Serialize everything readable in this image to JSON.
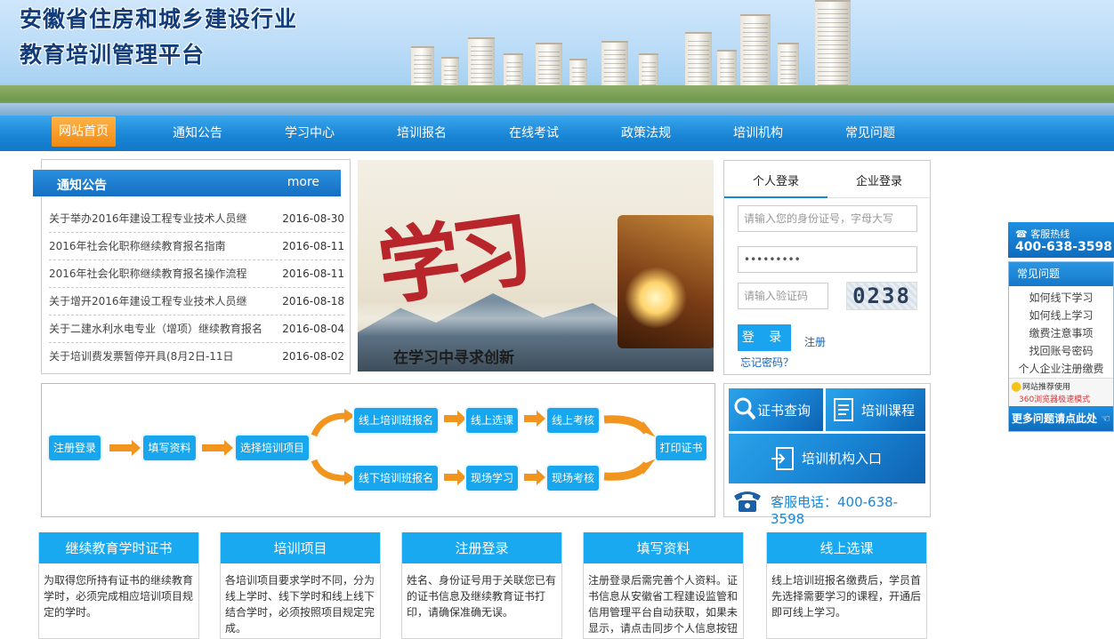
{
  "banner": {
    "title_line1": "安徽省住房和城乡建设行业",
    "title_line2": "教育培训管理平台"
  },
  "nav": {
    "items": [
      {
        "label": "网站首页",
        "active": true
      },
      {
        "label": "通知公告"
      },
      {
        "label": "学习中心"
      },
      {
        "label": "培训报名"
      },
      {
        "label": "在线考试"
      },
      {
        "label": "政策法规"
      },
      {
        "label": "培训机构"
      },
      {
        "label": "常见问题"
      }
    ]
  },
  "notice": {
    "title": "通知公告",
    "more": "more",
    "items": [
      {
        "title": "关于举办2016年建设工程专业技术人员继",
        "date": "2016-08-30"
      },
      {
        "title": "2016年社会化职称继续教育报名指南",
        "date": "2016-08-11"
      },
      {
        "title": "2016年社会化职称继续教育报名操作流程",
        "date": "2016-08-11"
      },
      {
        "title": "关于增开2016年建设工程专业技术人员继",
        "date": "2016-08-18"
      },
      {
        "title": "关于二建水利水电专业（增项）继续教育报名",
        "date": "2016-08-04"
      },
      {
        "title": "关于培训费发票暂停开具(8月2日-11日",
        "date": "2016-08-02"
      }
    ]
  },
  "slide": {
    "big_text": "学习",
    "caption": "在学习中寻求创新"
  },
  "login": {
    "tab_personal": "个人登录",
    "tab_company": "企业登录",
    "id_placeholder": "请输入您的身份证号，字母大写",
    "password_value": "•••••••••",
    "captcha_placeholder": "请输入验证码",
    "captcha_text": "0238",
    "submit": "登 录",
    "register": "注册",
    "forgot": "忘记密码？"
  },
  "flow": {
    "steps": {
      "register": "注册登录",
      "fill": "填写资料",
      "select": "选择培训项目",
      "online_signup": "线上培训班报名",
      "online_course": "线上选课",
      "online_exam": "线上考核",
      "offline_signup": "线下培训班报名",
      "onsite_study": "现场学习",
      "onsite_exam": "现场考核",
      "print": "打印证书"
    },
    "accent": "#18a7ee",
    "arrow_color": "#f2951f"
  },
  "quick": {
    "cert_query": "证书查询",
    "courses": "培训课程",
    "org_entry": "培训机构入口",
    "phone": "客服电话：400-638-3598"
  },
  "float": {
    "hotline_label": "客服热线",
    "hotline_number": "400-638-3598",
    "faq_title": "常见问题",
    "faq_items": [
      "如何线下学习",
      "如何线上学习",
      "缴费注意事项",
      "找回账号密码",
      "个人企业注册缴费"
    ],
    "recommend": "网站推荐使用",
    "browser": "360浏览器极速模式",
    "more": "更多问题请点此处"
  },
  "cards": [
    {
      "title": "继续教育学时证书",
      "body": "为取得您所持有证书的继续教育学时，必须完成相应培训项目规定的学时。"
    },
    {
      "title": "培训项目",
      "body": "各培训项目要求学时不同，分为线上学时、线下学时和线上线下结合学时，必须按照项目规定完成。"
    },
    {
      "title": "注册登录",
      "body": "姓名、身份证号用于关联您已有的证书信息及继续教育证书打印，请确保准确无误。"
    },
    {
      "title": "填写资料",
      "body": "注册登录后需完善个人资料。证书信息从安徽省工程建设监管和信用管理平台自动获取，如果未显示，请点击同步个人信息按钮"
    },
    {
      "title": "线上选课",
      "body": "线上培训班报名缴费后，学员首先选择需要学习的课程，开通后即可线上学习。"
    }
  ]
}
